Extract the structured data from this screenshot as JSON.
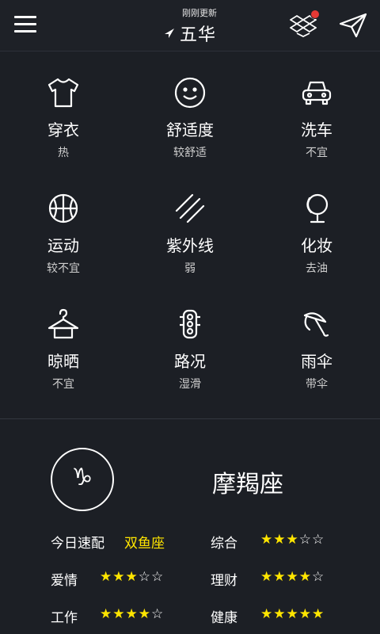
{
  "header": {
    "updated": "刚刚更新",
    "city": "五华"
  },
  "life_index": [
    {
      "name": "穿衣",
      "value": "热",
      "icon": "tshirt-icon"
    },
    {
      "name": "舒适度",
      "value": "较舒适",
      "icon": "smiley-icon"
    },
    {
      "name": "洗车",
      "value": "不宜",
      "icon": "car-icon"
    },
    {
      "name": "运动",
      "value": "较不宜",
      "icon": "basketball-icon"
    },
    {
      "name": "紫外线",
      "value": "弱",
      "icon": "uv-rays-icon"
    },
    {
      "name": "化妆",
      "value": "去油",
      "icon": "mirror-icon"
    },
    {
      "name": "晾晒",
      "value": "不宜",
      "icon": "hanger-icon"
    },
    {
      "name": "路况",
      "value": "湿滑",
      "icon": "traffic-light-icon"
    },
    {
      "name": "雨伞",
      "value": "带伞",
      "icon": "umbrella-icon"
    }
  ],
  "horoscope": {
    "symbol": "♑",
    "sign": "摩羯座",
    "match_label": "今日速配",
    "match_value": "双鱼座",
    "ratings": [
      {
        "label": "综合",
        "stars": 3
      },
      {
        "label": "爱情",
        "stars": 3
      },
      {
        "label": "理财",
        "stars": 4
      },
      {
        "label": "工作",
        "stars": 4
      },
      {
        "label": "健康",
        "stars": 5
      }
    ]
  },
  "colors": {
    "background": "#1c1f25",
    "accent": "#ffe500",
    "badge": "#e53935"
  }
}
